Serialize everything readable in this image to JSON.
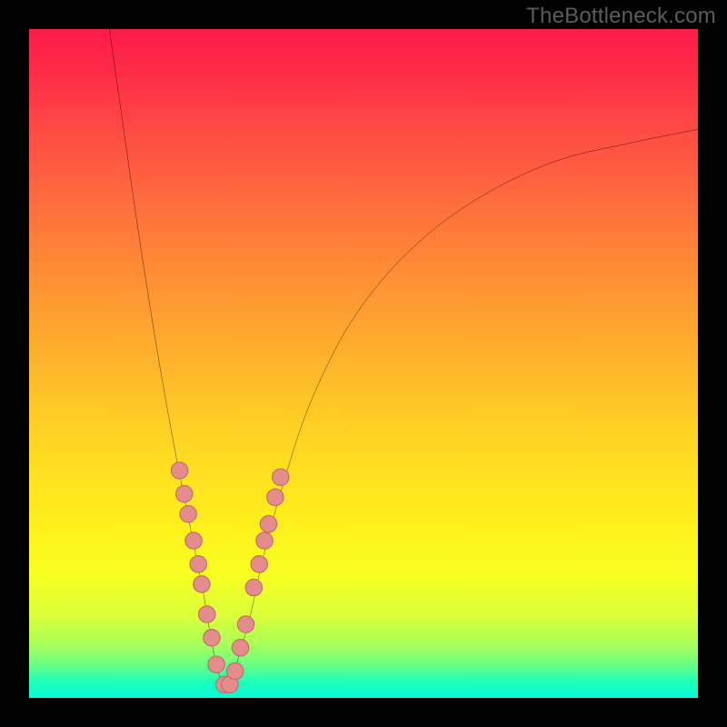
{
  "watermark": {
    "text": "TheBottleneck.com"
  },
  "colors": {
    "background": "#000000",
    "curve": "#000000",
    "marker_fill": "#e58c8c",
    "marker_stroke": "#c06868"
  },
  "chart_data": {
    "type": "line",
    "title": "",
    "xlabel": "",
    "ylabel": "",
    "xlim": [
      0,
      100
    ],
    "ylim": [
      0,
      100
    ],
    "grid": false,
    "legend": false,
    "note": "V-shaped bottleneck curve on rainbow gradient; minimum near x≈29. Values are visually estimated (no axis ticks shown).",
    "series": [
      {
        "name": "curve",
        "x": [
          12,
          14,
          16,
          18,
          20,
          22,
          24,
          26,
          27,
          28,
          29,
          30,
          31,
          33,
          35,
          38,
          42,
          48,
          56,
          66,
          78,
          90,
          100
        ],
        "y": [
          100,
          86,
          72,
          59,
          47,
          36,
          26,
          16,
          10,
          5,
          2,
          2,
          5,
          12,
          21,
          32,
          44,
          56,
          66,
          74,
          80,
          83,
          85
        ]
      }
    ],
    "markers": {
      "name": "highlighted-points",
      "x": [
        22.5,
        23.2,
        23.8,
        24.6,
        25.3,
        25.8,
        26.6,
        27.3,
        28.0,
        29.2,
        30.0,
        30.8,
        31.6,
        32.4,
        33.6,
        34.4,
        35.2,
        35.8,
        36.8,
        37.6
      ],
      "y": [
        34.0,
        30.5,
        27.5,
        23.5,
        20.0,
        17.0,
        12.5,
        9.0,
        5.0,
        2.0,
        2.0,
        4.0,
        7.5,
        11.0,
        16.5,
        20.0,
        23.5,
        26.0,
        30.0,
        33.0
      ]
    }
  }
}
